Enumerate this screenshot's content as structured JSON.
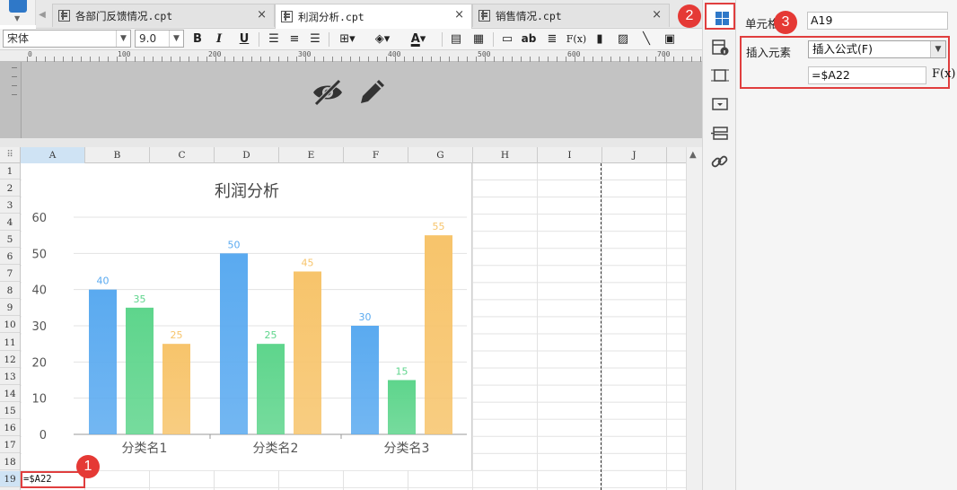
{
  "tabs": [
    {
      "label": "各部门反馈情况.cpt",
      "active": false,
      "close": "×"
    },
    {
      "label": "利润分析.cpt",
      "active": true,
      "close": "×"
    },
    {
      "label": "销售情况.cpt",
      "active": false,
      "close": "×"
    }
  ],
  "toolbar": {
    "font_name": "宋体",
    "font_size": "9.0",
    "bold": "B",
    "italic": "I",
    "underline": "U",
    "text_ab": "ab",
    "formula": "F(x)",
    "font_color": "A"
  },
  "ruler": {
    "labels": [
      "0",
      "100",
      "200",
      "300",
      "400",
      "500",
      "600",
      "700"
    ]
  },
  "header_icons": [
    "eye-slash-icon",
    "pencil-icon"
  ],
  "sheet": {
    "select_all": "⠿",
    "columns": [
      "A",
      "B",
      "C",
      "D",
      "E",
      "F",
      "G",
      "H",
      "I",
      "J"
    ],
    "selected_column": "A",
    "rows": [
      "1",
      "2",
      "3",
      "4",
      "5",
      "6",
      "7",
      "8",
      "9",
      "10",
      "11",
      "12",
      "13",
      "14",
      "15",
      "16",
      "17",
      "18",
      "19"
    ],
    "selected_row": "19",
    "cell_a19_value": "=$A22"
  },
  "chart_data": {
    "type": "bar",
    "title": "利润分析",
    "categories": [
      "分类名1",
      "分类名2",
      "分类名3"
    ],
    "series": [
      {
        "values": [
          40,
          50,
          30
        ],
        "color": "#5aaaf0"
      },
      {
        "values": [
          35,
          25,
          15
        ],
        "color": "#5ed58c"
      },
      {
        "values": [
          25,
          45,
          55
        ],
        "color": "#f7c46b"
      }
    ],
    "ylim": [
      0,
      60
    ],
    "yticks": [
      "0",
      "10",
      "20",
      "30",
      "40",
      "50",
      "60"
    ],
    "grid": true,
    "data_labels": true
  },
  "side_panel": {
    "icons": [
      "cell-element-icon",
      "cell-attribute-icon",
      "float-element-icon",
      "widget-icon",
      "condition-attribute-icon",
      "hyperlink-icon"
    ]
  },
  "properties": {
    "cell_label": "单元格",
    "cell_value": "A19",
    "insert_label": "插入元素",
    "insert_selected": "插入公式(F)",
    "formula_value": "=$A22",
    "fx_label": "F(x)"
  },
  "callouts": [
    "1",
    "2",
    "3"
  ],
  "colors": {
    "accent": "#2f78c8",
    "highlight": "#e03e3e",
    "selection": "#cfe3f4"
  }
}
